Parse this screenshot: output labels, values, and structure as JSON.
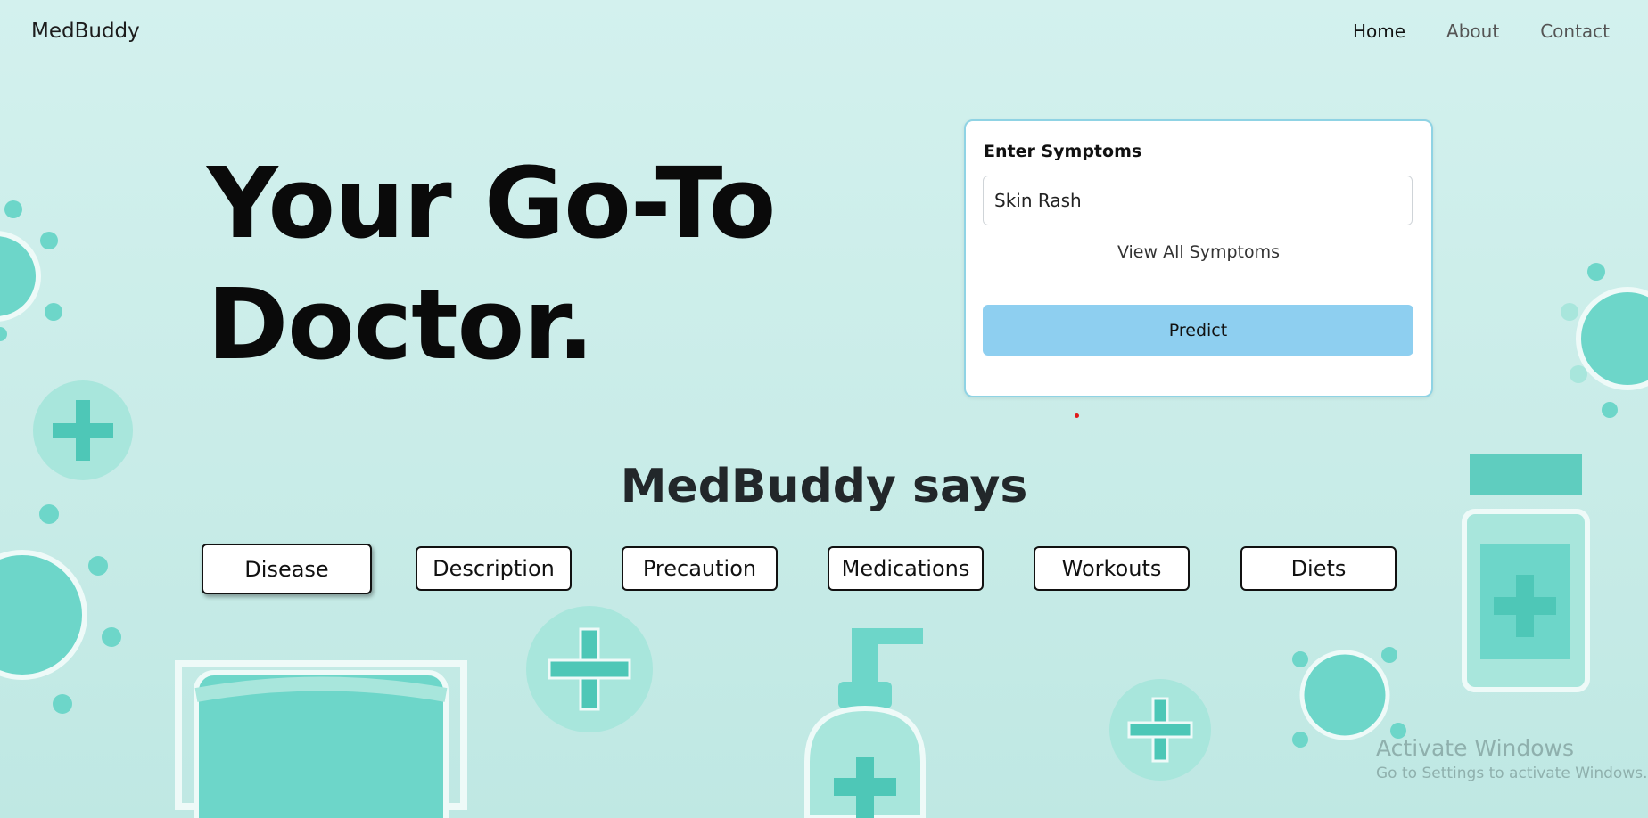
{
  "nav": {
    "brand": "MedBuddy",
    "links": [
      {
        "label": "Home",
        "active": true
      },
      {
        "label": "About",
        "active": false
      },
      {
        "label": "Contact",
        "active": false
      }
    ]
  },
  "hero": {
    "line1": "Your Go-To",
    "line2": "Doctor."
  },
  "form": {
    "label": "Enter Symptoms",
    "input_value": "Skin Rash",
    "view_all": "View All Symptoms",
    "predict": "Predict"
  },
  "results": {
    "title": "MedBuddy says",
    "tabs": [
      "Disease",
      "Description",
      "Precaution",
      "Medications",
      "Workouts",
      "Diets"
    ]
  },
  "watermark": {
    "line1": "Activate Windows",
    "line2": "Go to Settings to activate Windows."
  },
  "colors": {
    "accent": "#8ecff0",
    "teal": "#6dd6c9",
    "background": "#d3f1ee"
  }
}
